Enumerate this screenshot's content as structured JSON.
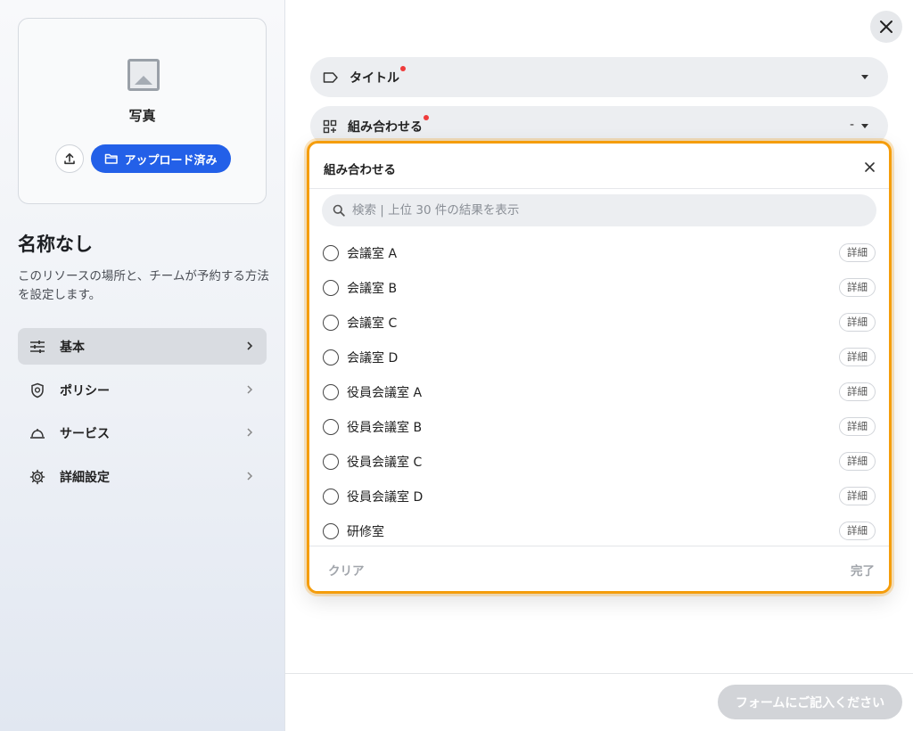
{
  "sidebar": {
    "photo_label": "写真",
    "upload_button_label": "アップロード済み",
    "title": "名称なし",
    "description": "このリソースの場所と、チームが予約する方法を設定します。",
    "items": [
      {
        "label": "基本",
        "icon": "sliders-icon",
        "active": true
      },
      {
        "label": "ポリシー",
        "icon": "shield-icon",
        "active": false
      },
      {
        "label": "サービス",
        "icon": "bell-icon",
        "active": false
      },
      {
        "label": "詳細設定",
        "icon": "gear-icon",
        "active": false
      }
    ]
  },
  "form": {
    "title_field_label": "タイトル",
    "combine_field_label": "組み合わせる",
    "combine_field_value": "-"
  },
  "popup": {
    "title": "組み合わせる",
    "search_placeholder": "検索 | 上位 30 件の結果を表示",
    "detail_label": "詳細",
    "options": [
      "会議室 A",
      "会議室 B",
      "会議室 C",
      "会議室 D",
      "役員会議室 A",
      "役員会議室 B",
      "役員会議室 C",
      "役員会議室 D",
      "研修室"
    ],
    "clear_label": "クリア",
    "done_label": "完了"
  },
  "footer": {
    "submit_label": "フォームにご記入ください"
  },
  "colors": {
    "accent": "#2360e8",
    "highlight": "#f59d0b",
    "required_dot": "#ef3b3b"
  }
}
